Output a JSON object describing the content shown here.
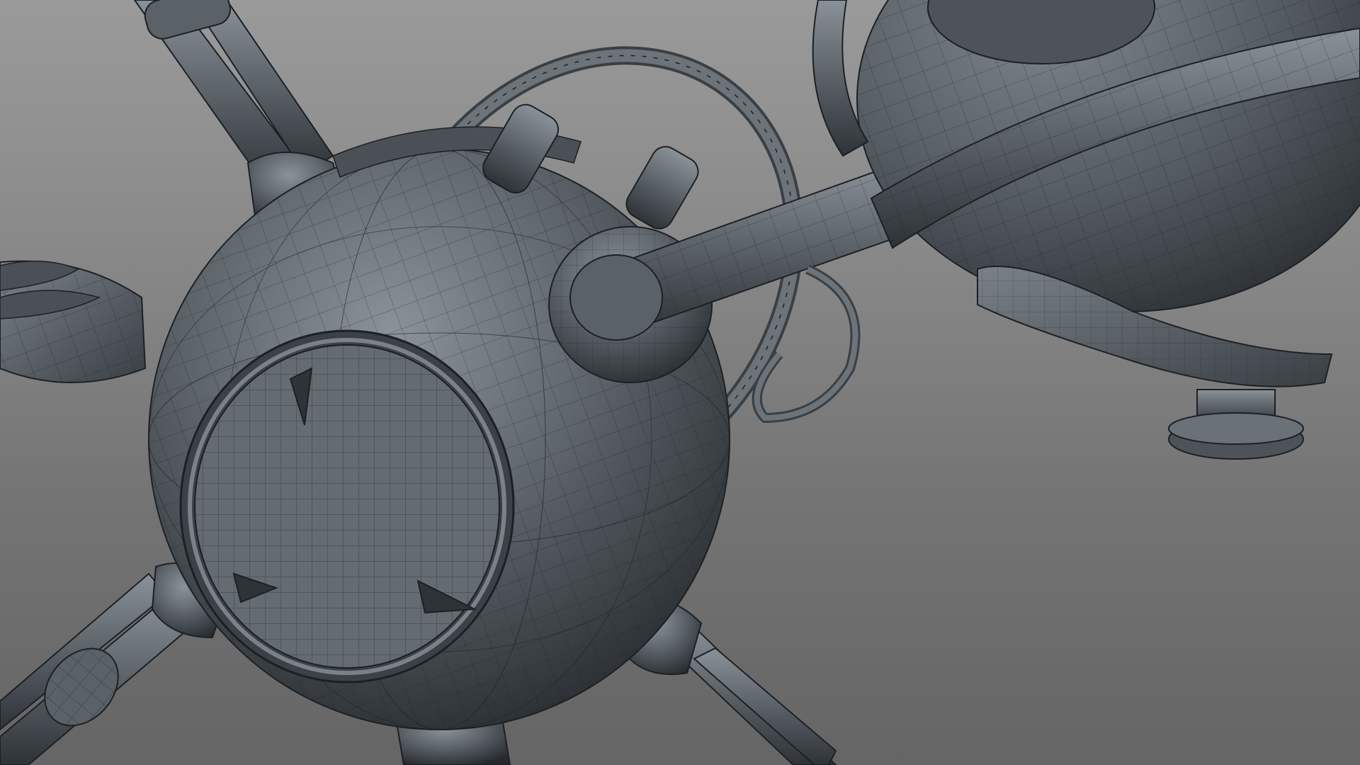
{
  "viewport": {
    "background_top": "#9a9a9a",
    "background_bottom": "#656565",
    "render_mode": "wireframe-on-shaded"
  },
  "model": {
    "surface_color": "#5f666c",
    "surface_highlight": "#8a9299",
    "surface_shadow": "#2f3438",
    "wire_color": "#1c2024"
  }
}
